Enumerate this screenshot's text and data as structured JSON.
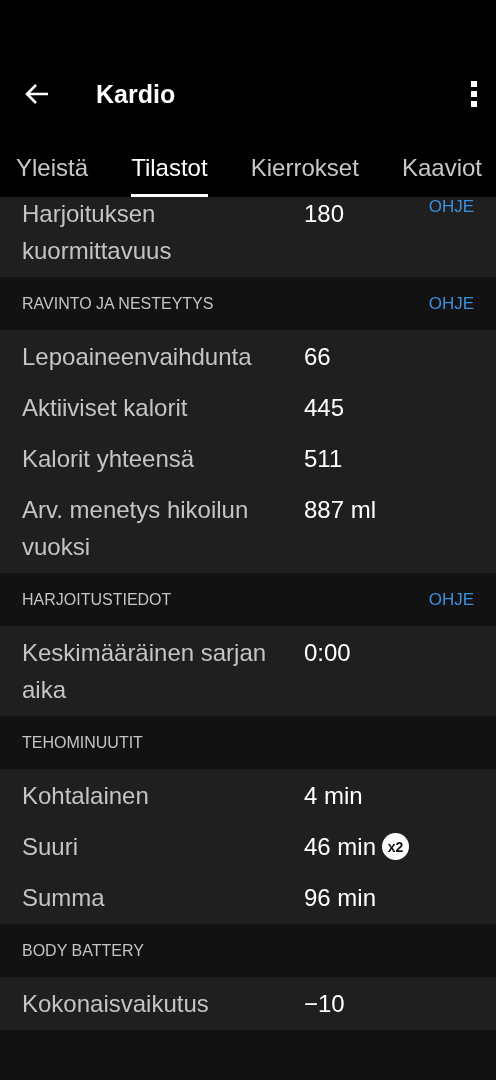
{
  "app_bar": {
    "title": "Kardio"
  },
  "tabs": [
    {
      "label": "Yleistä",
      "selected": false
    },
    {
      "label": "Tilastot",
      "selected": true
    },
    {
      "label": "Kierrokset",
      "selected": false
    },
    {
      "label": "Kaaviot",
      "selected": false
    }
  ],
  "partial_row": {
    "label": "Harjoituksen kuormittavuus",
    "value": "180",
    "help": "OHJE"
  },
  "sections": [
    {
      "title": "RAVINTO JA NESTEYTYS",
      "help": "OHJE",
      "rows": [
        {
          "label": "Lepoaineenvaihdunta",
          "value": "66"
        },
        {
          "label": "Aktiiviset kalorit",
          "value": "445"
        },
        {
          "label": "Kalorit yhteensä",
          "value": "511"
        },
        {
          "label": "Arv. menetys hikoilun vuoksi",
          "value": "887 ml"
        }
      ]
    },
    {
      "title": "HARJOITUSTIEDOT",
      "help": "OHJE",
      "rows": [
        {
          "label": "Keskimääräinen sarjan aika",
          "value": "0:00"
        }
      ]
    },
    {
      "title": "TEHOMINUUTIT",
      "rows": [
        {
          "label": "Kohtalainen",
          "value": "4 min"
        },
        {
          "label": "Suuri",
          "value": "46 min",
          "badge": "x2"
        },
        {
          "label": "Summa",
          "value": "96 min"
        }
      ]
    },
    {
      "title": "BODY BATTERY",
      "rows": [
        {
          "label": "Kokonaisvaikutus",
          "value": "−10"
        }
      ]
    }
  ]
}
